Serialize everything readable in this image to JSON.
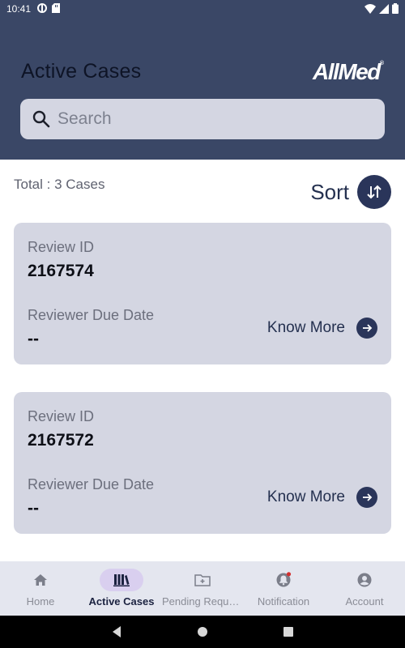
{
  "status_bar": {
    "time": "10:41"
  },
  "header": {
    "title": "Active Cases",
    "logo_text": "AllMed",
    "logo_mark": "®"
  },
  "search": {
    "placeholder": "Search",
    "value": ""
  },
  "summary": {
    "total_text": "Total : 3 Cases"
  },
  "sort": {
    "label": "Sort",
    "icon": "sort-arrows-icon"
  },
  "cases": [
    {
      "review_id_label": "Review ID",
      "review_id": "2167574",
      "due_date_label": "Reviewer Due Date",
      "due_date": "--",
      "action_label": "Know More"
    },
    {
      "review_id_label": "Review ID",
      "review_id": "2167572",
      "due_date_label": "Reviewer Due Date",
      "due_date": "--",
      "action_label": "Know More"
    }
  ],
  "bottom_nav": [
    {
      "label": "Home",
      "icon": "home-icon",
      "active": false
    },
    {
      "label": "Active Cases",
      "icon": "binders-icon",
      "active": true
    },
    {
      "label": "Pending Reque...",
      "icon": "folder-icon",
      "active": false
    },
    {
      "label": "Notification",
      "icon": "bell-icon",
      "active": false,
      "badge": true
    },
    {
      "label": "Account",
      "icon": "account-icon",
      "active": false
    }
  ],
  "colors": {
    "header_bg": "#3a4766",
    "card_bg": "#d4d6e2",
    "accent": "#2a355a",
    "nav_active_pill": "#d9cfef",
    "badge": "#d32f2f"
  }
}
